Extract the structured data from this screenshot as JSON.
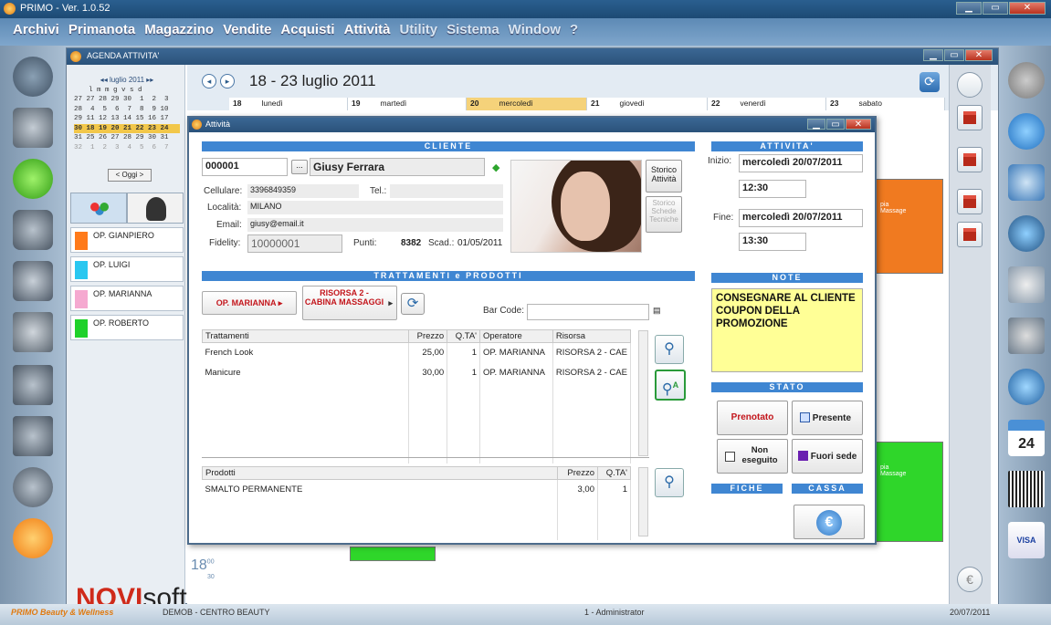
{
  "app": {
    "title": "PRIMO - Ver. 1.0.52"
  },
  "menu": [
    "Archivi",
    "Primanota",
    "Magazzino",
    "Vendite",
    "Acquisti",
    "Attività",
    "Utility",
    "Sistema",
    "Window",
    "?"
  ],
  "agenda": {
    "title": "AGENDA ATTIVITA'",
    "week_title": "18 - 23 luglio 2011",
    "calendar": {
      "month": "luglio 2011",
      "header": "l m m g v s d",
      "rows": [
        "27 27 28 29 30  1  2  3",
        "28  4  5  6  7  8  9 10",
        "29 11 12 13 14 15 16 17",
        "30 18 19 20 21 22 23 24",
        "31 25 26 27 28 29 30 31",
        "32  1  2  3  4  5  6  7"
      ],
      "highlight_row": 3,
      "today_label": "< Oggi >"
    },
    "operators": [
      {
        "name": "OP. GIANPIERO",
        "color": "#ff7a1a"
      },
      {
        "name": "OP. LUIGI",
        "color": "#29c7f0"
      },
      {
        "name": "OP. MARIANNA",
        "color": "#f5a9d0"
      },
      {
        "name": "OP. ROBERTO",
        "color": "#1fd12a"
      }
    ],
    "days": [
      {
        "num": "18",
        "name": "lunedì"
      },
      {
        "num": "19",
        "name": "martedì"
      },
      {
        "num": "20",
        "name": "mercoledì",
        "selected": true
      },
      {
        "num": "21",
        "name": "giovedì"
      },
      {
        "num": "22",
        "name": "venerdì"
      },
      {
        "num": "23",
        "name": "sabato"
      }
    ],
    "time_label": "18",
    "time_sub_top": "00",
    "time_sub_bottom": "30",
    "appointment_text_1": "pia",
    "appointment_text_2": "Massage",
    "logo": {
      "brand_a": "NOVI",
      "brand_b": "soft"
    }
  },
  "attivita": {
    "title": "Attività",
    "cliente": {
      "section": "CLIENTE",
      "code": "000001",
      "name": "Giusy Ferrara",
      "cellulare_label": "Cellulare:",
      "cellulare": "3396849359",
      "tel_label": "Tel.:",
      "tel": "",
      "localita_label": "Località:",
      "localita": "MILANO",
      "email_label": "Email:",
      "email": "giusy@email.it",
      "fidelity_label": "Fidelity:",
      "fidelity": "10000001",
      "punti_label": "Punti:",
      "punti": "8382",
      "scad_label": "Scad.:",
      "scad": "01/05/2011",
      "storico_attivita": "Storico Attività",
      "storico_schede": "Storico Schede Tecniche",
      "dots": "..."
    },
    "attivita_section": {
      "section": "ATTIVITA'",
      "inizio_label": "Inizio:",
      "inizio_date": "mercoledì 20/07/2011",
      "inizio_time": "12:30",
      "fine_label": "Fine:",
      "fine_date": "mercoledì 20/07/2011",
      "fine_time": "13:30"
    },
    "trattamenti_section": {
      "section": "TRATTAMENTI e PRODOTTI",
      "operator_btn": "OP. MARIANNA",
      "risorsa_btn": "RISORSA 2 - CABINA MASSAGGI",
      "barcode_label": "Bar Code:",
      "barcode": ""
    },
    "trattamenti_table": {
      "headers": [
        "Trattamenti",
        "Prezzo",
        "Q.TA'",
        "Operatore",
        "Risorsa"
      ],
      "rows": [
        [
          "French Look",
          "25,00",
          "1",
          "OP. MARIANNA",
          "RISORSA 2 - CAE"
        ],
        [
          "Manicure",
          "30,00",
          "1",
          "OP. MARIANNA",
          "RISORSA 2 - CAE"
        ]
      ]
    },
    "prodotti_table": {
      "headers": [
        "Prodotti",
        "Prezzo",
        "Q.TA'"
      ],
      "rows": [
        [
          "SMALTO PERMANENTE",
          "3,00",
          "1"
        ]
      ]
    },
    "note": {
      "section": "NOTE",
      "text": "CONSEGNARE AL CLIENTE COUPON DELLA PROMOZIONE"
    },
    "stato": {
      "section": "STATO",
      "prenotato": "Prenotato",
      "presente": "Presente",
      "non_eseguito": "Non eseguito",
      "fuori_sede": "Fuori sede"
    },
    "fiche": "FICHE",
    "cassa": "CASSA"
  },
  "status": {
    "brand": "PRIMO Beauty & Wellness",
    "db": "DEMOB - CENTRO BEAUTY",
    "user": "1 - Administrator",
    "date": "20/07/2011"
  },
  "colors": {
    "accent": "#3f86d2",
    "note_bg": "#ffff96",
    "red_text": "#c3161c"
  }
}
